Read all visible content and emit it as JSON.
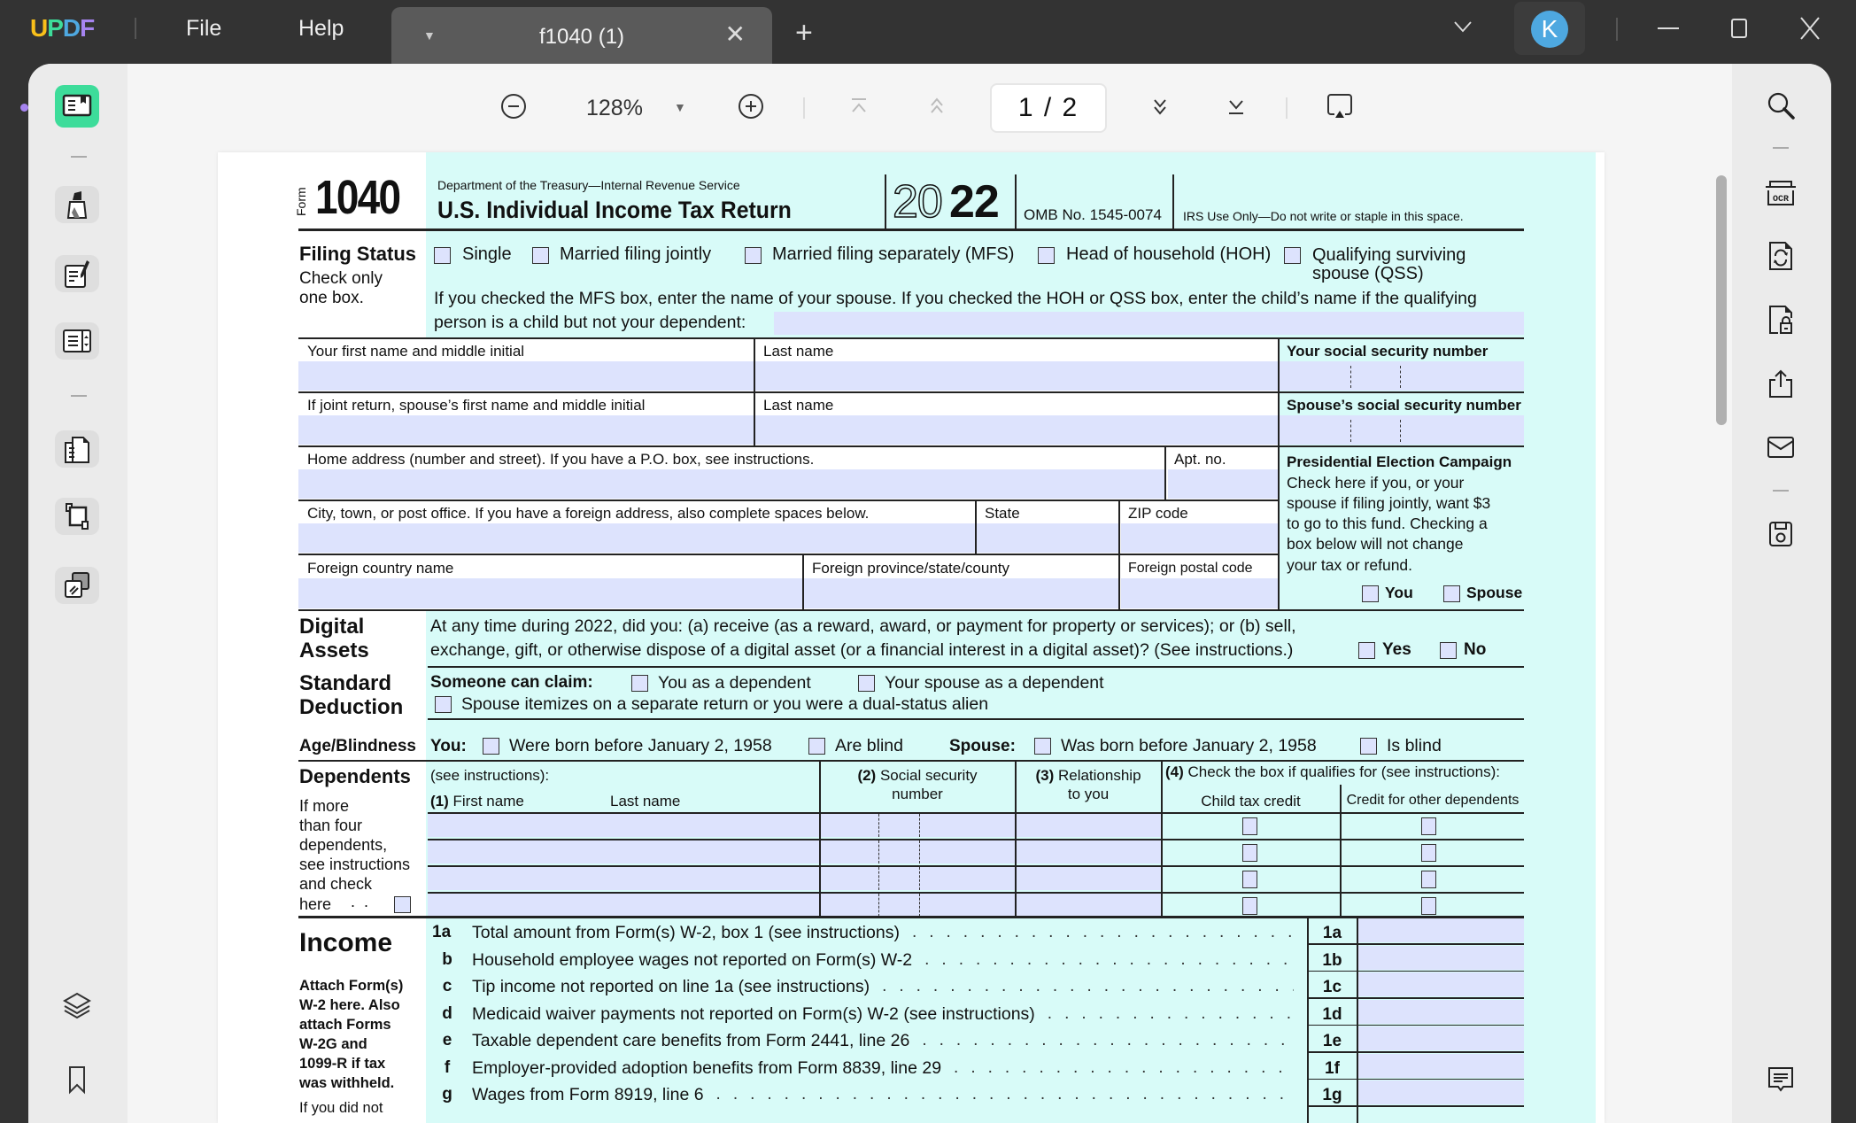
{
  "app": {
    "logo": [
      "U",
      "P",
      "D",
      "F"
    ],
    "logo_colors": [
      "#f9c01a",
      "#3ddc9a",
      "#4ea8e0",
      "#a684f0"
    ],
    "menu": {
      "file": "File",
      "help": "Help"
    },
    "tab": {
      "title": "f1040 (1)",
      "dropdown_icon": "▼",
      "close_icon": "✕"
    },
    "new_tab_icon": "+",
    "avatar_initial": "K",
    "accent": "#3ddc9a"
  },
  "toolbar": {
    "zoom_level": "128%",
    "zoom_dropdown_icon": "▼",
    "page_indicator": "1 / 2",
    "current_page": 1,
    "total_pages": 2
  },
  "form": {
    "form_label": "Form",
    "form_number": "1040",
    "department": "Department of the Treasury—Internal Revenue Service",
    "title": "U.S. Individual Income Tax Return",
    "year_outline": "20",
    "year_bold": "22",
    "omb": "OMB No. 1545-0074",
    "irs_use": "IRS Use Only—Do not write or staple in this space.",
    "filing_status": {
      "heading": "Filing Status",
      "sub1": "Check only",
      "sub2": "one box.",
      "options": [
        "Single",
        "Married filing jointly",
        "Married filing separately (MFS)",
        "Head of household (HOH)",
        "Qualifying surviving",
        "spouse (QSS)"
      ],
      "instr1": "If you checked the MFS box, enter the name of your spouse. If you checked the HOH or QSS box, enter the child’s name if the qualifying",
      "instr2": "person is a child but not your dependent:"
    },
    "name_fields": {
      "first": "Your first name and middle initial",
      "last": "Last name",
      "ssn": "Your social security number",
      "spouse_first": "If joint return, spouse’s first name and middle initial",
      "spouse_last": "Last name",
      "spouse_ssn": "Spouse’s social security number",
      "home": "Home address (number and street). If you have a P.O. box, see instructions.",
      "apt": "Apt. no.",
      "city": "City, town, or post office. If you have a foreign address, also complete spaces below.",
      "state": "State",
      "zip": "ZIP code",
      "country": "Foreign country name",
      "province": "Foreign province/state/county",
      "postal": "Foreign postal code"
    },
    "presidential": {
      "heading": "Presidential Election Campaign",
      "lines": [
        "Check here if you, or your",
        "spouse if filing jointly, want $3",
        "to go to this fund. Checking a",
        "box below will not change",
        "your tax or refund."
      ],
      "you": "You",
      "spouse": "Spouse"
    },
    "digital": {
      "heading1": "Digital",
      "heading2": "Assets",
      "line1": "At any time during 2022, did you: (a) receive (as a reward, award, or payment for property or services); or (b) sell,",
      "line2": "exchange, gift, or otherwise dispose of a digital asset (or a financial interest in a digital asset)? (See instructions.)",
      "yes": "Yes",
      "no": "No"
    },
    "standard": {
      "heading1": "Standard",
      "heading2": "Deduction",
      "claim": "Someone can claim:",
      "opt1": "You as a dependent",
      "opt2": "Your spouse as a dependent",
      "opt3": "Spouse itemizes on a separate return or you were a dual-status alien"
    },
    "age": {
      "heading": "Age/Blindness",
      "you": "You:",
      "you_born": "Were born before January 2, 1958",
      "you_blind": "Are blind",
      "spouse": "Spouse:",
      "spouse_born": "Was born before January 2, 1958",
      "spouse_blind": "Is blind"
    },
    "dependents": {
      "heading": "Dependents",
      "see": "(see instructions):",
      "side": [
        "If more",
        "than four",
        "dependents,",
        "see instructions",
        "and check",
        "here"
      ],
      "col1_num": "(1)",
      "col1": "First name",
      "col1b": "Last name",
      "col2_num": "(2)",
      "col2a": "Social security",
      "col2b": "number",
      "col3_num": "(3)",
      "col3a": "Relationship",
      "col3b": "to you",
      "col4_num": "(4)",
      "col4": "Check the box if qualifies for (see instructions):",
      "col4a": "Child tax credit",
      "col4b": "Credit for other dependents"
    },
    "income": {
      "heading": "Income",
      "attach": [
        "Attach Form(s)",
        "W-2 here. Also",
        "attach Forms",
        "W-2G and",
        "1099-R if tax",
        "was withheld."
      ],
      "ifnot": "If you did not",
      "lines": [
        {
          "num": "1a",
          "text": "Total amount from Form(s) W-2, box 1 (see instructions)",
          "box": "1a"
        },
        {
          "num": "b",
          "text": "Household employee wages not reported on Form(s) W-2",
          "box": "1b"
        },
        {
          "num": "c",
          "text": "Tip income not reported on line 1a (see instructions)",
          "box": "1c"
        },
        {
          "num": "d",
          "text": "Medicaid waiver payments not reported on Form(s) W-2 (see instructions)",
          "box": "1d"
        },
        {
          "num": "e",
          "text": "Taxable dependent care benefits from Form 2441, line 26",
          "box": "1e"
        },
        {
          "num": "f",
          "text": "Employer-provided adoption benefits from Form 8839, line 29",
          "box": "1f"
        },
        {
          "num": "g",
          "text": "Wages from Form 8919, line 6",
          "box": "1g"
        }
      ]
    }
  }
}
